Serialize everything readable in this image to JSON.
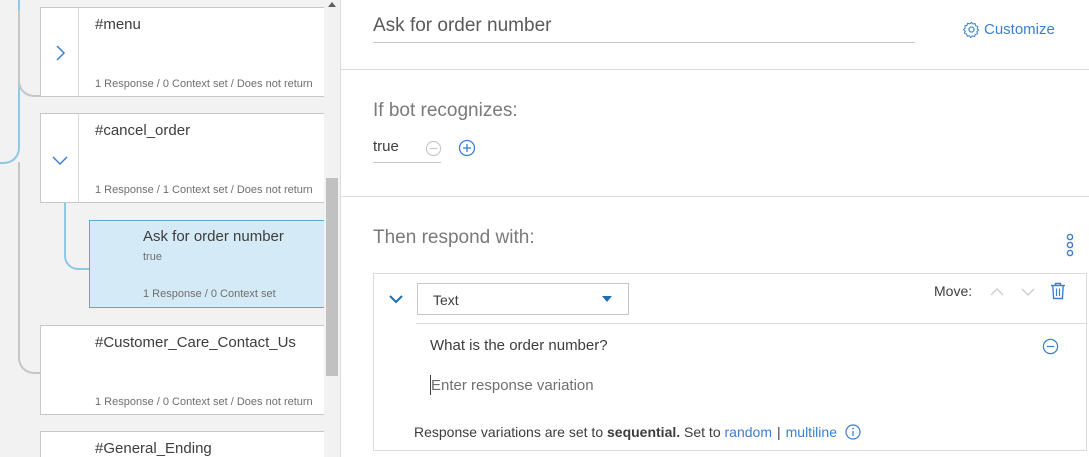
{
  "tree": {
    "nodes": [
      {
        "title": "#menu",
        "meta": "1 Response / 0 Context set / Does not return",
        "toggle": "chevron-right-icon"
      },
      {
        "title": "#cancel_order",
        "meta": "1 Response / 1 Context set / Does not return",
        "toggle": "chevron-down-icon"
      },
      {
        "title": "#Customer_Care_Contact_Us",
        "meta": "1 Response / 0 Context set / Does not return"
      },
      {
        "title": "#General_Ending"
      }
    ],
    "selected_child": {
      "title": "Ask for order number",
      "condition": "true",
      "meta": "1 Response / 0 Context set"
    }
  },
  "editor": {
    "node_name": "Ask for order number",
    "customize_label": "Customize",
    "condition_label": "If bot recognizes:",
    "condition_value": "true",
    "response_label": "Then respond with:",
    "response": {
      "type": "Text",
      "move_label": "Move:",
      "variations": [
        "What is the order number?"
      ],
      "variation_placeholder": "Enter response variation",
      "note_prefix": "Response variations are set to",
      "note_mode": "sequential.",
      "note_set_to": "Set to",
      "note_random": "random",
      "note_separator": "|",
      "note_multiline": "multiline"
    }
  },
  "colors": {
    "accent": "#3a7fd1",
    "selected_bg": "#d4eaf6",
    "selected_border": "#5aaad7",
    "connector": "#8fc7e6"
  }
}
